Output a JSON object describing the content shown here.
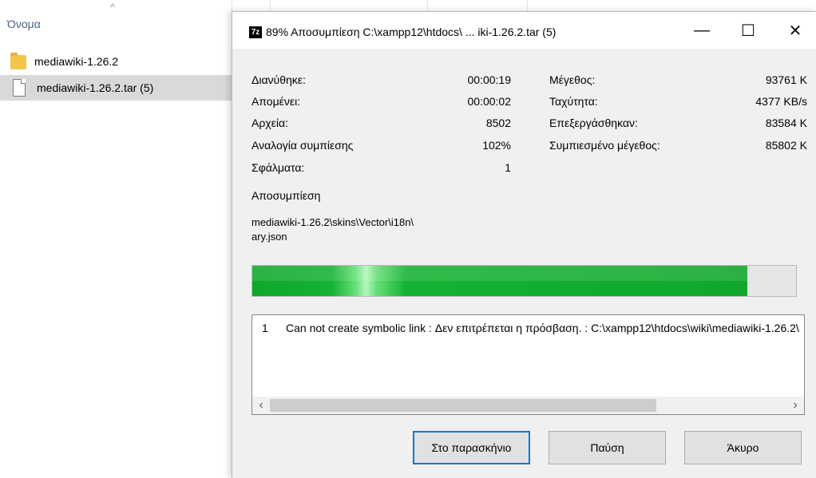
{
  "explorer": {
    "column_header": "Όνομα",
    "sort_indicator": "^",
    "files": [
      {
        "name": "mediawiki-1.26.2",
        "type": "folder",
        "selected": false
      },
      {
        "name": "mediawiki-1.26.2.tar (5)",
        "type": "file",
        "selected": true
      }
    ]
  },
  "dialog": {
    "app_icon": "7z",
    "title": "89% Αποσυμπίεση C:\\xampp12\\htdocs\\ ... iki-1.26.2.tar (5)",
    "window_buttons": {
      "minimize": "—",
      "maximize": "☐",
      "close": "✕"
    },
    "left_stats": [
      {
        "label": "Διανύθηκε:",
        "value": "00:00:19"
      },
      {
        "label": "Απομένει:",
        "value": "00:00:02"
      },
      {
        "label": "Αρχεία:",
        "value": "8502"
      },
      {
        "label": "Αναλογία συμπίεσης",
        "value": "102%"
      },
      {
        "label": "Σφάλματα:",
        "value": "1"
      }
    ],
    "right_stats": [
      {
        "label": "Μέγεθος:",
        "value": "93761 K"
      },
      {
        "label": "Ταχύτητα:",
        "value": "4377 KB/s"
      },
      {
        "label": "Επεξεργάσθηκαν:",
        "value": "83584 K"
      },
      {
        "label": "Συμπιεσμένο μέγεθος:",
        "value": "85802 K"
      }
    ],
    "operation": "Αποσυμπίεση",
    "current_file_line1": "mediawiki-1.26.2\\skins\\Vector\\i18n\\",
    "current_file_line2": "ary.json",
    "progress_fraction": 0.91,
    "progress_color": "#0fa82b",
    "errors": [
      {
        "num": "1",
        "message": "Can not create symbolic link : Δεν επιτρέπεται η πρόσβαση. : C:\\xampp12\\htdocs\\wiki\\mediawiki-1.26.2\\"
      }
    ],
    "scroll_left": "‹",
    "scroll_right": "›",
    "buttons": {
      "background": "Στο παρασκήνιο",
      "pause": "Παύση",
      "cancel": "Άκυρο"
    }
  }
}
